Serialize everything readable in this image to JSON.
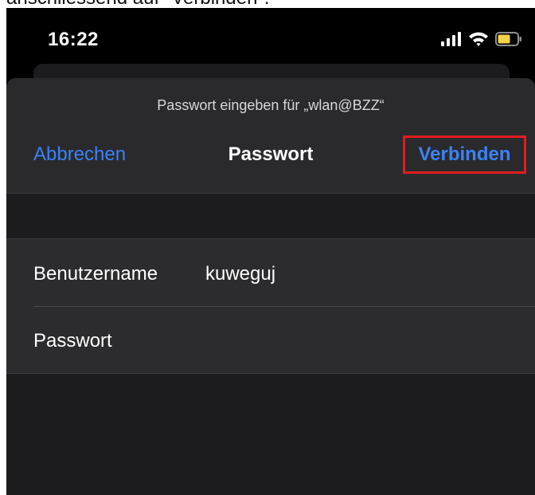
{
  "caption": "anschliessend auf \"Verbinden\".",
  "status_bar": {
    "time": "16:22",
    "icons": [
      "cellular-signal-icon",
      "wifi-icon",
      "battery-icon"
    ],
    "battery_color": "#f5d547"
  },
  "dialog": {
    "prompt": "Passwort eingeben für „wlan@BZZ“",
    "cancel_label": "Abbrechen",
    "title": "Passwort",
    "connect_label": "Verbinden",
    "highlight_color": "#e11d1d",
    "accent_color": "#3b82f6"
  },
  "form": {
    "username_label": "Benutzername",
    "username_value": "kuweguj",
    "password_label": "Passwort",
    "password_value": ""
  }
}
